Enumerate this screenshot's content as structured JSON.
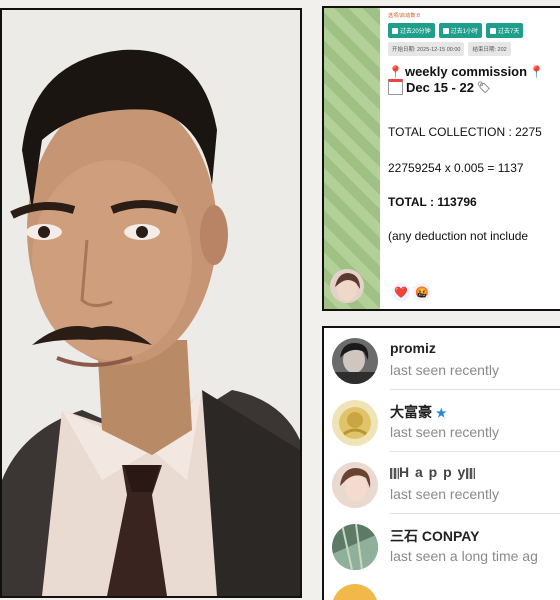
{
  "chat": {
    "header_label": "选项/启动数:8",
    "chips": [
      "过去20分钟",
      "过去1小时",
      "过去7天"
    ],
    "start_date": "开始日期: 2025-12-15 00:00",
    "end_date": "结束日期: 202",
    "title": "weekly commission",
    "date_range": "Dec 15 - 22",
    "total_collection": "TOTAL COLLECTION : 2275",
    "calc": "22759254  x 0.005  =  1137",
    "total": "TOTAL :  113796",
    "note": "(any deduction not include",
    "reactions": [
      "❤️",
      "🤬"
    ]
  },
  "contacts": [
    {
      "name": "promiz",
      "status": "last seen recently"
    },
    {
      "name": "大富豪",
      "status": "last seen recently",
      "star": "★"
    },
    {
      "name": "H a p p y",
      "status": "last seen recently"
    },
    {
      "name": "三石 CONPAY",
      "status": "last seen a long time ag"
    }
  ],
  "colors": {
    "chat_bg": "#a9c98d",
    "chip": "#1e9e8b",
    "status_gray": "#8a8a8a",
    "star_blue": "#2b87d8"
  }
}
